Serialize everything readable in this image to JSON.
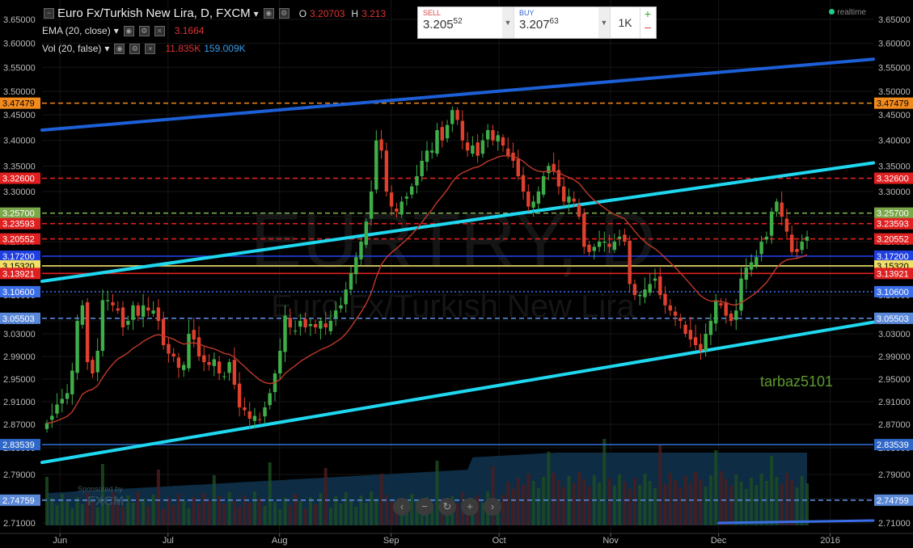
{
  "header": {
    "symbol_title": "Euro Fx/Turkish New Lira, D, FXCM",
    "open_label": "O",
    "open_value": "3.20703",
    "high_label": "H",
    "high_value": "3.213",
    "ema_label": "EMA (20, close)",
    "ema_value": "3.1664",
    "vol_label": "Vol (20, false)",
    "vol_value1": "11.835K",
    "vol_value2": "159.009K"
  },
  "trade_panel": {
    "sell_label": "SELL",
    "sell_price_main": "3.205",
    "sell_price_sup": "5",
    "sell_price_tail": "2",
    "buy_label": "BUY",
    "buy_price_main": "3.207",
    "buy_price_sup": "6",
    "buy_price_tail": "3",
    "quantity": "1K",
    "plus": "+",
    "minus": "–"
  },
  "status": {
    "realtime": "realtime"
  },
  "watermark": {
    "big": "EURTRY, D",
    "small": "Euro Fx/Turkish New Lira"
  },
  "signature": "tarbaz5101",
  "sponsor": {
    "line1": "Sponsored by",
    "line2": "FXCM"
  },
  "zoom_controls": [
    "‹",
    "−",
    "↻",
    "+",
    "›"
  ],
  "colors": {
    "up": "#3fae49",
    "down": "#e0402e",
    "ema": "#c0392b",
    "background": "#000000",
    "channel": "#1fd8f0",
    "upper_trend": "#1d5fd6"
  },
  "chart_data": {
    "type": "candlestick",
    "title": "Euro Fx/Turkish New Lira, D, FXCM",
    "y_axis": {
      "ticks": [
        "3.65000",
        "3.60000",
        "3.55000",
        "3.50000",
        "3.45000",
        "3.40000",
        "3.35000",
        "3.30000",
        "3.25000",
        "3.20000",
        "3.15000",
        "3.10000",
        "3.05000",
        "3.03000",
        "2.99000",
        "2.95000",
        "2.91000",
        "2.87000",
        "2.83000",
        "2.79000",
        "2.75000",
        "2.71000"
      ]
    },
    "x_axis": {
      "labels": [
        "Jun",
        "Jul",
        "Aug",
        "Sep",
        "Oct",
        "Nov",
        "Dec",
        "2016"
      ]
    },
    "horizontal_levels": [
      {
        "value": "3.47479",
        "color": "#f28b1e",
        "style": "dashed"
      },
      {
        "value": "3.32600",
        "color": "#e02020",
        "style": "dashed"
      },
      {
        "value": "3.25700",
        "color": "#7aa84a",
        "style": "dashed"
      },
      {
        "value": "3.23593",
        "color": "#e02020",
        "style": "dashed"
      },
      {
        "value": "3.20552",
        "color": "#e02020",
        "style": "dashed"
      },
      {
        "value": "3.17200",
        "color": "#1f3fe0",
        "style": "solid"
      },
      {
        "value": "3.15320",
        "color": "#f0e068",
        "style": "solid"
      },
      {
        "value": "3.13921",
        "color": "#e02020",
        "style": "solid"
      },
      {
        "value": "3.10600",
        "color": "#3a6ee8",
        "style": "dotted"
      },
      {
        "value": "3.05503",
        "color": "#5a88d8",
        "style": "dashed"
      },
      {
        "value": "2.83539",
        "color": "#2e67c8",
        "style": "solid"
      },
      {
        "value": "2.74759",
        "color": "#5a88d8",
        "style": "dashed"
      }
    ],
    "trendlines": [
      {
        "name": "upper",
        "color": "#1d5fd6",
        "from": {
          "x": "2015-05-27",
          "y": 3.42
        },
        "to": {
          "x": "2016-01-13",
          "y": 3.567
        }
      },
      {
        "name": "channel-top",
        "color": "#1fd8f0",
        "from": {
          "x": "2015-05-27",
          "y": 3.125
        },
        "to": {
          "x": "2016-01-13",
          "y": 3.356
        }
      },
      {
        "name": "channel-bottom",
        "color": "#1fd8f0",
        "from": {
          "x": "2015-05-27",
          "y": 2.808
        },
        "to": {
          "x": "2016-01-13",
          "y": 3.048
        }
      },
      {
        "name": "volume-trend",
        "color": "#3a6ee8",
        "from": {
          "x": "2015-12-01",
          "y": 2.693
        },
        "to": {
          "x": "2016-01-13",
          "y": 2.714
        }
      }
    ],
    "candles_close": [
      2.872,
      2.885,
      2.905,
      2.915,
      2.925,
      2.965,
      3.05,
      3.08,
      2.98,
      2.96,
      3.0,
      3.09,
      3.09,
      3.08,
      3.07,
      3.04,
      3.05,
      3.08,
      3.06,
      3.08,
      3.07,
      3.07,
      3.05,
      3.01,
      2.995,
      2.99,
      2.97,
      2.975,
      3.03,
      3.02,
      2.99,
      2.98,
      2.975,
      2.985,
      2.96,
      2.955,
      2.98,
      2.94,
      2.9,
      2.895,
      2.88,
      2.885,
      2.878,
      2.9,
      2.925,
      2.96,
      3.0,
      3.06,
      3.04,
      3.035,
      3.05,
      3.04,
      3.045,
      3.04,
      3.05,
      3.04,
      3.05,
      3.07,
      3.08,
      3.11,
      3.14,
      3.17,
      3.2,
      3.24,
      3.3,
      3.4,
      3.38,
      3.3,
      3.27,
      3.26,
      3.28,
      3.29,
      3.31,
      3.33,
      3.36,
      3.38,
      3.38,
      3.42,
      3.4,
      3.43,
      3.46,
      3.44,
      3.4,
      3.38,
      3.39,
      3.37,
      3.4,
      3.42,
      3.4,
      3.41,
      3.39,
      3.37,
      3.36,
      3.33,
      3.3,
      3.27,
      3.28,
      3.3,
      3.33,
      3.35,
      3.34,
      3.31,
      3.28,
      3.29,
      3.28,
      3.25,
      3.19,
      3.18,
      3.19,
      3.2,
      3.2,
      3.19,
      3.2,
      3.21,
      3.2,
      3.12,
      3.1,
      3.1,
      3.11,
      3.12,
      3.13,
      3.1,
      3.08,
      3.07,
      3.06,
      3.05,
      3.03,
      3.02,
      3.01,
      3.0,
      3.03,
      3.05,
      3.09,
      3.08,
      3.06,
      3.05,
      3.07,
      3.13,
      3.15,
      3.16,
      3.17,
      3.2,
      3.21,
      3.26,
      3.28,
      3.25,
      3.22,
      3.18,
      3.18,
      3.2,
      3.21
    ]
  }
}
